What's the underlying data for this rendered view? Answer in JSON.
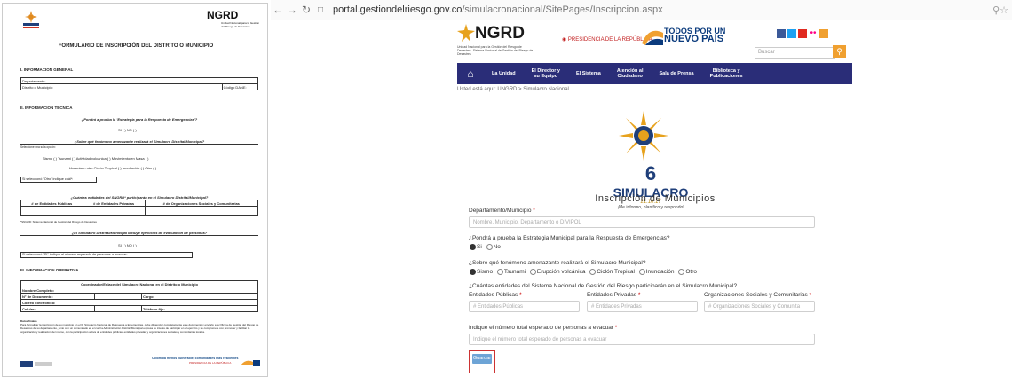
{
  "doc": {
    "logo_left_text": "SIMULACRO",
    "logo_right_text": "NGRD",
    "logo_right_sub": "Unidad Nacional para la Gestión del Riesgo de Desastres",
    "title": "FORMULARIO DE INSCRIPCIÓN DEL DISTRITO O MUNICIPIO",
    "sec1": "I.   INFORMACION GENERAL",
    "gen_rows": [
      "Departamento:",
      "Distrito o Municipio:"
    ],
    "codigo_dane": "Código DANE:",
    "sec2": "II.   INFORMACION TÉCNICA",
    "q1": "¿Pondrá a prueba la 'Estrategia para la Respuesta de Emergencias'?",
    "q1_opts": "SI (   )     NO (   )",
    "q2": "¿Sobre qué fenómeno amenazante realizará el Simulacro Distrital/Municipal?",
    "q2_hint": "Seleccione una sola opción:",
    "q2_line1": "Sismo  (   )         Tsunami  (   )         Actividad volcánica  (   )         Movimiento en Masa  (   )",
    "q2_line2": "Huracán u otro Ciclón Tropical  (   )     Inundación  (   )     Otro  (   )",
    "q2_otro": "Si seleccionó \"Otro\" indique cuál*:",
    "q3": "¿Cuántas entidades del SNGRD* participarán en el Simulacro Distrital/Municipal?",
    "q3_cols": [
      "# de Entidades Públicas",
      "# de Entidades Privadas",
      "# de Organizaciones Sociales y Comunitarias"
    ],
    "q3_note": "*SNGRD: Sistema Nacional de Gestión del Riesgo de Desastres",
    "q4": "¿El Simulacro Distrital/Municipal incluye ejercicios de evacuación de personas?",
    "q4_opts": "SI (   )     NO (   )",
    "q4_si": "Si seleccionó \"SI\" indique el número esperado de personas a evacuar:",
    "sec3": "III.   INFORMACION OPERATIVA",
    "op_title": "Coordinador/Enlace del Simulacro Nacional en el Distrito o Municipio",
    "op_rows": [
      "Nombre Completo:",
      "N° de Documento:",
      "Correo Electrónico:",
      "Celular:"
    ],
    "op_cargo": "Cargo:",
    "op_tel": "Teléfono fijo:",
    "note_title": "Datos finales",
    "note_text": "Para formalizar la inscripción de su municipio en el 6° Simulacro Nacional de Respuesta a Emergencias, debe diligenciar completamente este documento y enviarlo a la Oficina de Gestión del Riesgo de Desastres de su departamento, junto con un comunicado en el cual la Administración Distrital/Municipal expresa su interés de participar en el ejercicio y se compromete con promover y facilitar la organización y realización del mismo, con la participación activa de entidades públicas, entidades privadas y organizaciones sociales y comunitarias locales.",
    "foot_slogan": "Colombia menos vulnerable, comunidades más resilientes",
    "foot_presid": "PRESIDENCIA DE LA REPÚBLICA"
  },
  "browser": {
    "url_domain": "portal.gestiondelriesgo.gov.co",
    "url_path": "/simulacronacional/SitePages/Inscripcion.aspx"
  },
  "site": {
    "logo_text": "NGRD",
    "logo_sub": "Unidad Nacional para la Gestión del Riesgo de Desastres. Sistema Nacional de Gestión del Riesgo de Desastres",
    "presidencia": "PRESIDENCIA DE LA REPÚBLICA",
    "todos_line1": "TODOS POR UN",
    "todos_line2": "NUEVO PAÍS",
    "search_placeholder": "Buscar",
    "nav": [
      "La Unidad",
      "El Director y\nsu Equipo",
      "El Sistema",
      "Atención al\nCiudadano",
      "Sala de Prensa",
      "Biblioteca y\nPublicaciones"
    ],
    "breadcrumb": "Usted está aquí: UNGRD  >  Simulacro Nacional",
    "simul_num": "6",
    "simul_word": "SIMULACRO",
    "simul_date": "21.10.17",
    "simul_tag": "¡Me informo, planifico y respondo!"
  },
  "form": {
    "heading": "Inscripción de Municipios",
    "dept_label": "Departamento/Municipio",
    "dept_placeholder": "Nombre, Municipio, Departamento o DIVIPOL",
    "q1_label": "¿Pondrá a prueba la Estrategia Municipal para la Respuesta de Emergencias?",
    "q1_opts": [
      "Si",
      "No"
    ],
    "q2_label": "¿Sobre qué fenómeno amenazante realizará el Simulacro Municipal?",
    "q2_opts": [
      "Sismo",
      "Tsunami",
      "Erupción volcánica",
      "Ciclón Tropical",
      "Inundación",
      "Otro"
    ],
    "q3_label": "¿Cuántas entidades del Sistema Nacional de Gestión del Riesgo participarán en el Simulacro Municipal?",
    "q3_cols": [
      "Entidades Públicas",
      "Entidades Privadas",
      "Organizaciones Sociales y Comunitarias"
    ],
    "q3_placeholders": [
      "# Entidades Públicas",
      "# Entidades Privadas",
      "# Organizaciones Sociales y Comunita"
    ],
    "q4_label": "Indique el número total esperado de personas a evacuar",
    "q4_placeholder": "Indique el número total esperado de personas a evacuar",
    "save_label": "Guardar",
    "required_mark": "*"
  },
  "colors": {
    "nav_bg": "#2a2d78",
    "save_bg": "#6da4d6",
    "accent_orange": "#f0a030",
    "highlight_red": "#cc3333"
  }
}
